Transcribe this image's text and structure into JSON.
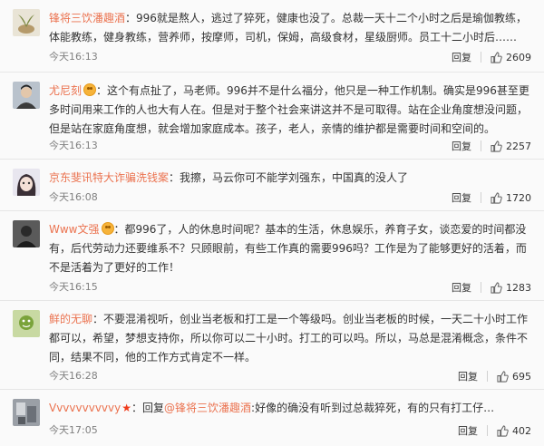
{
  "comments": [
    {
      "username": "锋将三饮潘趣酒",
      "text": "996就是熬人，逃过了猝死，健康也没了。总裁一天十二个小时之后是瑜伽教练，体能教练，健身教练，营养师，按摩师，司机，保姆，高级食材，星级厨师。员工十二小时后……",
      "time": "今天16:13",
      "reply": "回复",
      "likes": "2609",
      "avatar": "plant-avatar",
      "badge": false
    },
    {
      "username": "尤尼刻",
      "text": "这个有点扯了，马老师。996并不是什么福分，他只是一种工作机制。确实是996甚至更多时间用来工作的人也大有人在。但是对于整个社会来讲这并不是可取得。站在企业角度想没问题，但是站在家庭角度想，就会增加家庭成本。孩子，老人，亲情的维护都是需要时间和空间的。",
      "time": "今天16:13",
      "reply": "回复",
      "likes": "2257",
      "avatar": "person-avatar",
      "badge": true
    },
    {
      "username": "京东斐讯特大诈骗洗钱案",
      "text": "我擦，马云你可不能学刘强东，中国真的没人了",
      "time": "今天16:08",
      "reply": "回复",
      "likes": "1720",
      "avatar": "anime-avatar",
      "badge": false
    },
    {
      "username": "Www文强",
      "text": "都996了，人的休息时间呢？基本的生活，休息娱乐，养育子女，谈恋爱的时间都没有，后代劳动力还要维系不？只顾眼前，有些工作真的需要996吗？工作是为了能够更好的活着，而不是活着为了更好的工作！",
      "time": "今天16:15",
      "reply": "回复",
      "likes": "1283",
      "avatar": "dark-avatar",
      "badge": true
    },
    {
      "username": "鲜的无聊",
      "text": "不要混淆视听，创业当老板和打工是一个等级吗。创业当老板的时候，一天二十小时工作都可以，希望，梦想支持你，所以你可以二十小时。打工的可以吗。所以，马总是混淆概念，条件不同，结果不同，他的工作方式肯定不一样。",
      "time": "今天16:28",
      "reply": "回复",
      "likes": "695",
      "avatar": "green-avatar",
      "badge": false
    },
    {
      "username": "Vvvvvvvvvvy",
      "reply_prefix": "回复",
      "reply_to": "@锋将三饮潘趣酒",
      "text": ":好像的确没有听到过总裁猝死，有的只有打工仔…",
      "time": "今天17:05",
      "reply": "回复",
      "likes": "402",
      "avatar": "room-avatar",
      "star": "★"
    }
  ],
  "colors": {
    "username": "#eb7350",
    "time": "#808080",
    "badge": "#f6b33a"
  }
}
